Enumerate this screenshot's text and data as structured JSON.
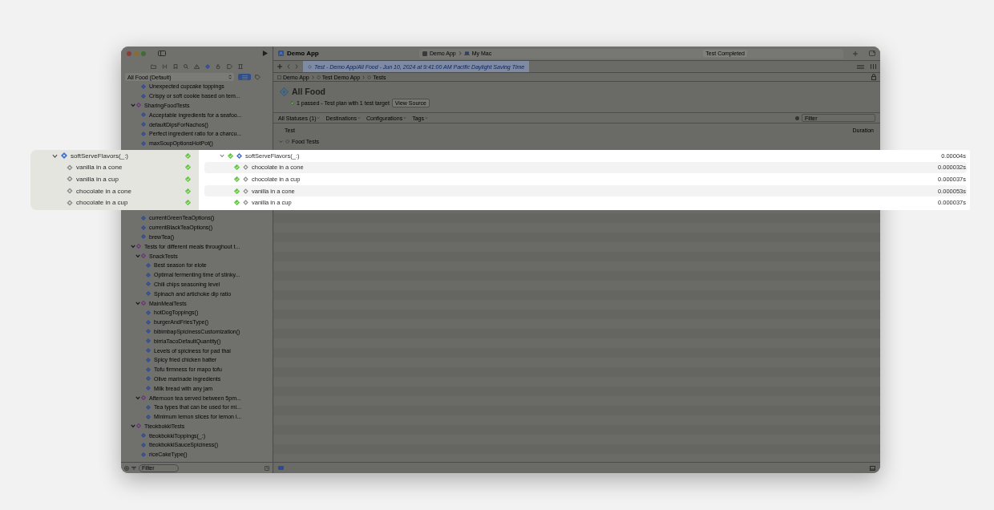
{
  "window": {
    "title": "Demo App",
    "scheme": [
      "Demo App",
      "My Mac"
    ],
    "status": "Test Completed"
  },
  "tab": {
    "label": "Test - Demo App/All Food - Jun 10, 2024 at 9:41:00 AM Pacific Daylight Saving Time",
    "selected": true
  },
  "breadcrumbs": [
    "Demo App",
    "Test Demo App",
    "Tests"
  ],
  "sidebar": {
    "plan": "All Food (Default)",
    "filter_placeholder": "Filter",
    "tree_top": [
      {
        "kind": "group_tail",
        "children": [
          {
            "kind": "test",
            "label": "Unexpected cupcake toppings"
          },
          {
            "kind": "test",
            "label": "Crispy or soft cookie based on tem..."
          }
        ]
      },
      {
        "kind": "suite",
        "label": "SharingFoodTests",
        "expanded": true,
        "children": [
          {
            "kind": "test",
            "label": "Acceptable ingredients for a seafoo..."
          },
          {
            "kind": "test",
            "label": "defaultDipsForNachos()"
          },
          {
            "kind": "test",
            "label": "Perfect ingredient ratio for a charcu..."
          },
          {
            "kind": "test",
            "label": "maxSoupOptionsHotPot()"
          }
        ]
      }
    ],
    "tree_bottom": [
      {
        "kind": "group_tail",
        "children": [
          {
            "kind": "test",
            "label": "currentGreenTeaOptions()"
          },
          {
            "kind": "test",
            "label": "currentBlackTeaOptions()"
          },
          {
            "kind": "test",
            "label": "brewTea()"
          }
        ]
      },
      {
        "kind": "suite",
        "label": "Tests for different meals throughout t...",
        "expanded": true,
        "children": [
          {
            "kind": "suite",
            "label": "SnackTests",
            "expanded": true,
            "children": [
              {
                "kind": "test",
                "label": "Best season for elote"
              },
              {
                "kind": "test",
                "label": "Optimal fermenting time of stinky..."
              },
              {
                "kind": "test",
                "label": "Chili chips seasoning level"
              },
              {
                "kind": "test",
                "label": "Spinach and artichoke dip ratio"
              }
            ]
          },
          {
            "kind": "suite",
            "label": "MainMealTests",
            "expanded": true,
            "children": [
              {
                "kind": "test",
                "label": "hotDogToppings()"
              },
              {
                "kind": "test",
                "label": "burgerAndFriesType()"
              },
              {
                "kind": "test",
                "label": "bibimbapSpicinessCustomization()"
              },
              {
                "kind": "test",
                "label": "birriaTacoDefaultQuantity()"
              },
              {
                "kind": "test",
                "label": "Levels of spiciness for pad thai"
              },
              {
                "kind": "test",
                "label": "Spicy fried chicken batter"
              },
              {
                "kind": "test",
                "label": "Tofu firmness for mapo tofu"
              },
              {
                "kind": "test",
                "label": "Olive marinade ingredients"
              },
              {
                "kind": "test",
                "label": "Milk bread with any jam"
              }
            ]
          },
          {
            "kind": "suite",
            "label": "Afternoon tea served between 5pm...",
            "expanded": true,
            "children": [
              {
                "kind": "test",
                "label": "Tea types that can be used for mi..."
              },
              {
                "kind": "test",
                "label": "Minimum lemon slices for lemon i..."
              }
            ]
          }
        ]
      },
      {
        "kind": "suite",
        "label": "TteokbokkiTests",
        "expanded": true,
        "children": [
          {
            "kind": "test",
            "label": "tteokbokkiToppings(_:)"
          },
          {
            "kind": "test",
            "label": "tteokbokkiSauceSpiciness()"
          },
          {
            "kind": "test",
            "label": "riceCakeType()"
          }
        ]
      }
    ]
  },
  "report": {
    "title": "All Food",
    "summary": "1 passed - Test plan with 1 test target",
    "view_source": "View Source",
    "filters": [
      "All Statuses (1)",
      "Destinations",
      "Configurations",
      "Tags"
    ],
    "filter_placeholder": "Filter",
    "columns": [
      "Test",
      "Duration"
    ],
    "group": {
      "label": "Food Tests",
      "expanded": true
    }
  },
  "highlight": {
    "sidebar": {
      "label": "softServeFlavors(_:)",
      "expanded": true,
      "passed": true,
      "children": [
        {
          "label": "vanilla in a cone",
          "passed": true
        },
        {
          "label": "vanilla in a cup",
          "passed": true
        },
        {
          "label": "chocolate in a cone",
          "passed": true
        },
        {
          "label": "chocolate in a cup",
          "passed": true
        }
      ]
    },
    "results": {
      "label": "softServeFlavors(_:)",
      "expanded": true,
      "passed": true,
      "duration": "0.00004s",
      "children": [
        {
          "label": "chocolate in a cone",
          "passed": true,
          "duration": "0.000032s"
        },
        {
          "label": "chocolate in a cup",
          "passed": true,
          "duration": "0.000037s"
        },
        {
          "label": "vanilla in a cone",
          "passed": true,
          "duration": "0.000053s"
        },
        {
          "label": "vanilla in a cup",
          "passed": true,
          "duration": "0.000037s"
        }
      ]
    }
  }
}
